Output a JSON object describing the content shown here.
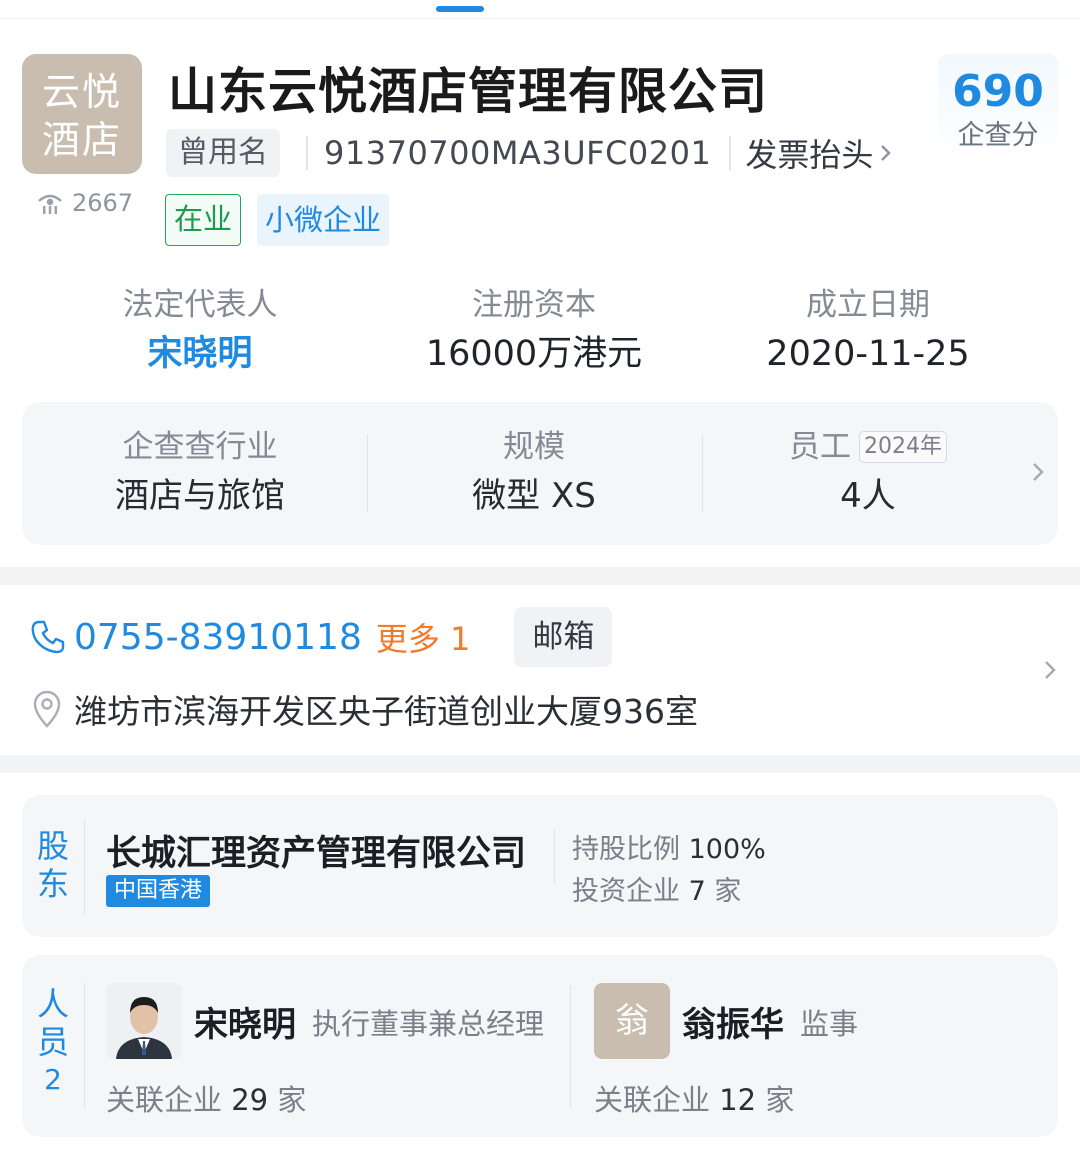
{
  "company": {
    "logo_line1": "云悦",
    "logo_line2": "酒店",
    "views": "2667",
    "name": "山东云悦酒店管理有限公司",
    "used_name_label": "曾用名",
    "credit_code": "91370700MA3UFC0201",
    "invoice_label": "发票抬头",
    "tags": {
      "status": "在业",
      "size": "小微企业"
    },
    "score": {
      "value": "690",
      "label": "企查分"
    }
  },
  "stats": [
    {
      "label": "法定代表人",
      "value": "宋晓明"
    },
    {
      "label": "注册资本",
      "value": "16000万港元"
    },
    {
      "label": "成立日期",
      "value": "2020-11-25"
    }
  ],
  "industry": [
    {
      "label": "企查查行业",
      "value": "酒店与旅馆"
    },
    {
      "label": "规模",
      "value": "微型 XS"
    },
    {
      "label": "员工",
      "badge": "2024年",
      "value": "4人"
    }
  ],
  "contact": {
    "phone": "0755-83910118",
    "more": "更多 1",
    "email_button": "邮箱",
    "address": "潍坊市滨海开发区央子街道创业大厦936室"
  },
  "shareholder": {
    "section_label_1": "股",
    "section_label_2": "东",
    "name": "长城汇理资产管理有限公司",
    "region": "中国香港",
    "ratio_label": "持股比例",
    "ratio_value": "100%",
    "invest_label": "投资企业",
    "invest_count": "7",
    "invest_unit": "家"
  },
  "people": {
    "section_label_1": "人",
    "section_label_2": "员",
    "count": "2",
    "list": [
      {
        "name": "宋晓明",
        "role": "执行董事兼总经理",
        "rel_label": "关联企业",
        "rel_count": "29",
        "rel_unit": "家"
      },
      {
        "name": "翁振华",
        "avatar_char": "翁",
        "role": "监事",
        "rel_label": "关联企业",
        "rel_count": "12",
        "rel_unit": "家"
      }
    ]
  },
  "colors": {
    "accent": "#1f8ae0",
    "status_green": "#1e9a4f",
    "orange": "#f07b2c",
    "logo_bg": "#c9bdaf"
  }
}
